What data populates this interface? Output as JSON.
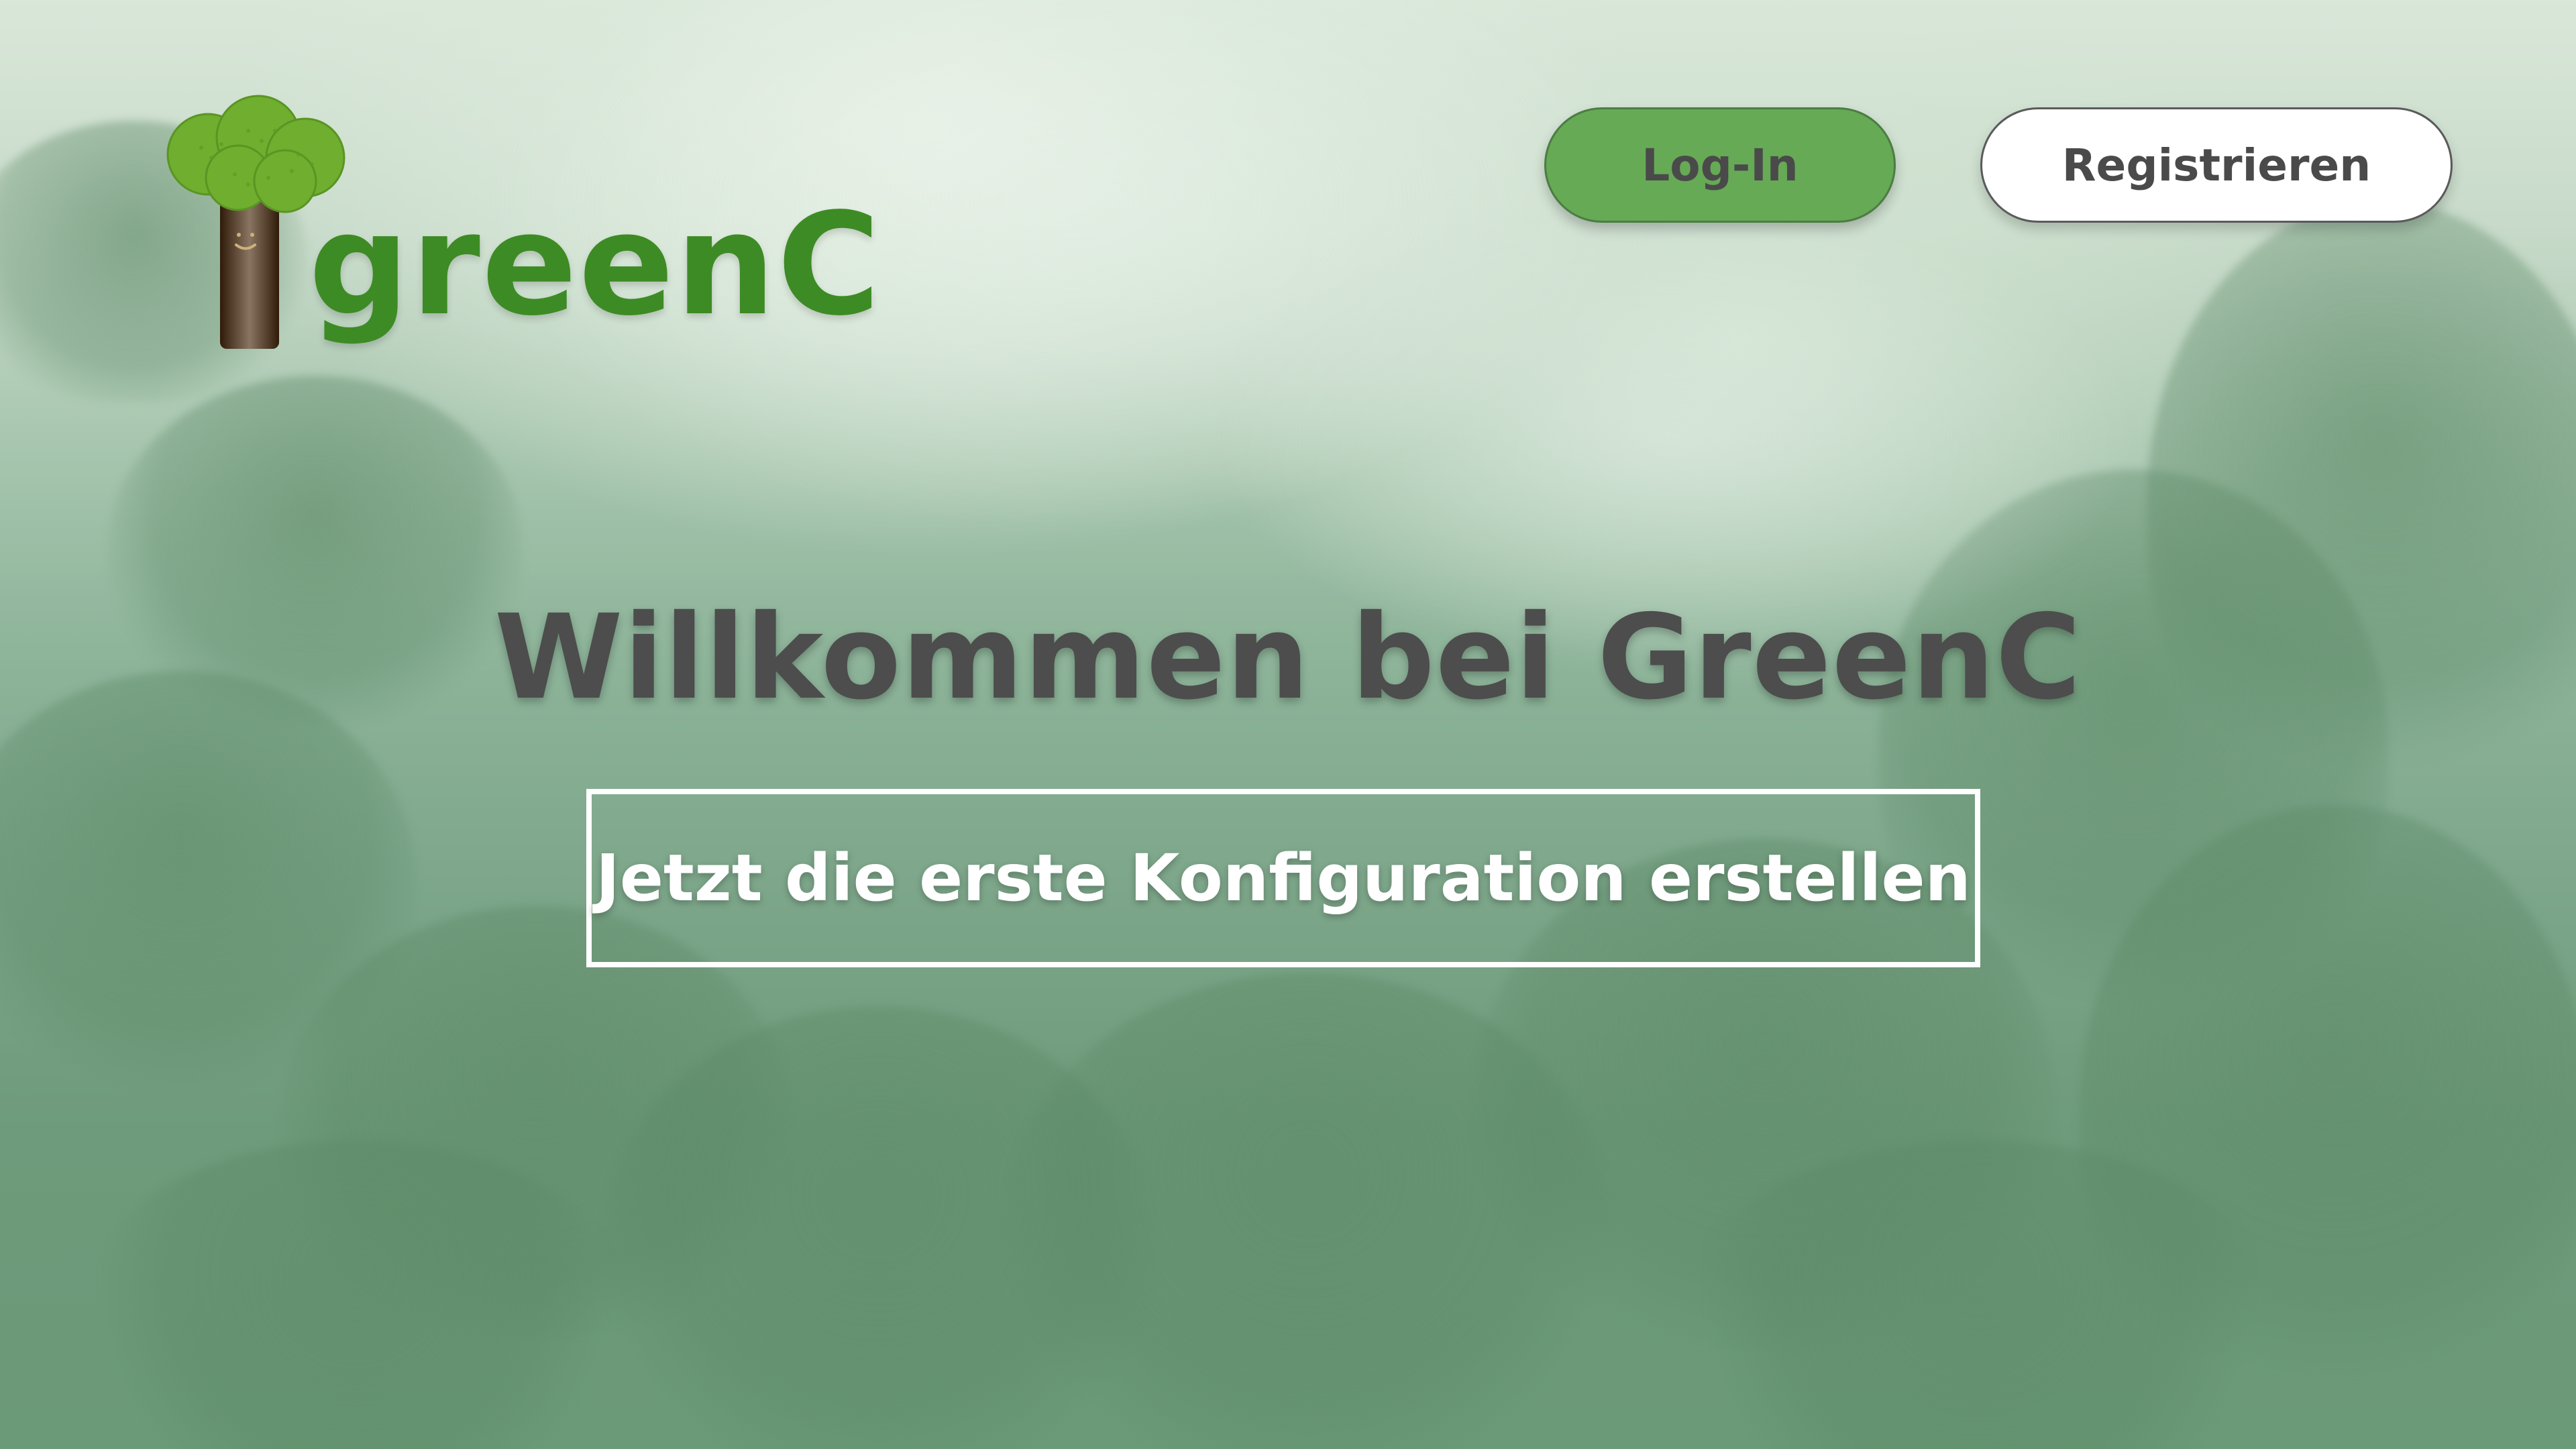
{
  "brand": {
    "name": "greenC",
    "logo_icon": "tree-with-face-icon",
    "colors": {
      "brand_green": "#3d8b24",
      "tree_canopy": "#6fae2e",
      "tree_trunk": "#4a2a0e"
    }
  },
  "header": {
    "login_label": "Log-In",
    "register_label": "Registrieren",
    "login_color": "#66aa55",
    "register_color": "#ffffff"
  },
  "hero": {
    "headline": "Willkommen bei GreenC",
    "cta_label": "Jetzt die erste Konfiguration erstellen"
  },
  "background": {
    "theme": "misty-forest",
    "colors": [
      "#d9e7d9",
      "#8fb59b",
      "#6b9a78"
    ]
  }
}
